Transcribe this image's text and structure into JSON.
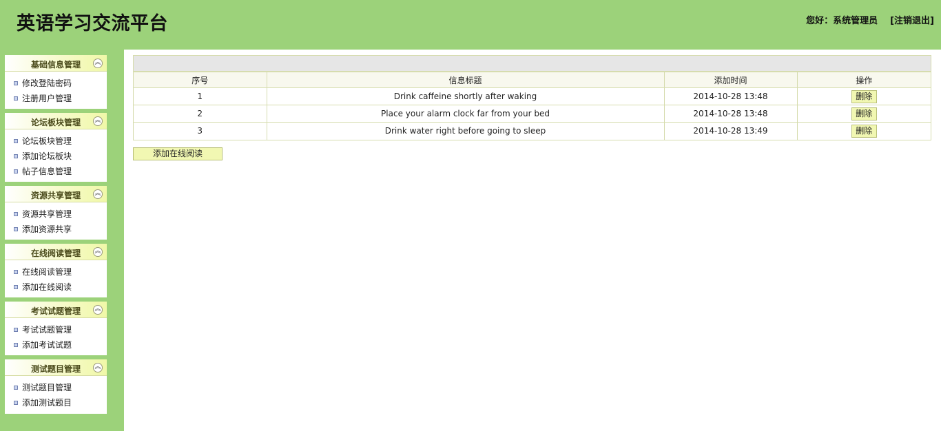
{
  "header": {
    "title": "英语学习交流平台",
    "greeting": "您好：系统管理员",
    "logout": "[注销退出]"
  },
  "sidebar": {
    "panels": [
      {
        "title": "基础信息管理",
        "items": [
          "修改登陆密码",
          "注册用户管理"
        ]
      },
      {
        "title": "论坛板块管理",
        "items": [
          "论坛板块管理",
          "添加论坛板块",
          "帖子信息管理"
        ]
      },
      {
        "title": "资源共享管理",
        "items": [
          "资源共享管理",
          "添加资源共享"
        ]
      },
      {
        "title": "在线阅读管理",
        "items": [
          "在线阅读管理",
          "添加在线阅读"
        ]
      },
      {
        "title": "考试试题管理",
        "items": [
          "考试试题管理",
          "添加考试试题"
        ]
      },
      {
        "title": "测试题目管理",
        "items": [
          "测试题目管理",
          "添加测试题目"
        ]
      }
    ]
  },
  "table": {
    "headers": [
      "序号",
      "信息标题",
      "添加时间",
      "操作"
    ],
    "rows": [
      {
        "index": "1",
        "title": "Drink caffeine shortly after waking",
        "time": "2014-10-28 13:48",
        "action": "删除"
      },
      {
        "index": "2",
        "title": "Place your alarm clock far from your bed",
        "time": "2014-10-28 13:48",
        "action": "删除"
      },
      {
        "index": "3",
        "title": "Drink water right before going to sleep",
        "time": "2014-10-28 13:49",
        "action": "删除"
      }
    ]
  },
  "add_button": "添加在线阅读"
}
